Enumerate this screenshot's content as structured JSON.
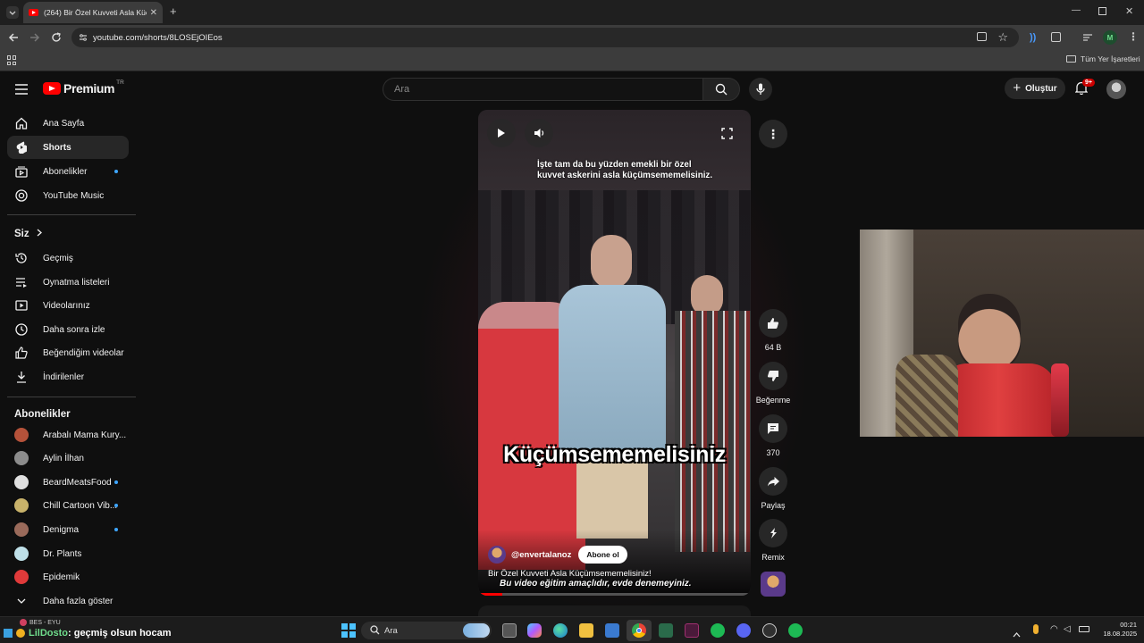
{
  "browser": {
    "tab_title": "(264) Bir Özel Kuvveti Asla Küçü",
    "url": "youtube.com/shorts/8LOSEjOIEos",
    "bookmarks_label": "Tüm Yer İşaretleri",
    "profile_initial": "M"
  },
  "header": {
    "logo_text": "Premium",
    "logo_region": "TR",
    "search_placeholder": "Ara",
    "create_label": "Oluştur",
    "notif_badge": "9+"
  },
  "sidebar": {
    "main": [
      {
        "label": "Ana Sayfa",
        "icon": "home-icon"
      },
      {
        "label": "Shorts",
        "icon": "shorts-icon",
        "active": true
      },
      {
        "label": "Abonelikler",
        "icon": "subscriptions-icon",
        "dot": true
      },
      {
        "label": "YouTube Music",
        "icon": "music-icon"
      }
    ],
    "you_title": "Siz",
    "you": [
      {
        "label": "Geçmiş",
        "icon": "history-icon"
      },
      {
        "label": "Oynatma listeleri",
        "icon": "playlist-icon"
      },
      {
        "label": "Videolarınız",
        "icon": "your-videos-icon"
      },
      {
        "label": "Daha sonra izle",
        "icon": "watch-later-icon"
      },
      {
        "label": "Beğendiğim videolar",
        "icon": "liked-icon"
      },
      {
        "label": "İndirilenler",
        "icon": "download-icon"
      }
    ],
    "subs_title": "Abonelikler",
    "subs": [
      {
        "label": "Arabalı Mama Kury...",
        "color": "#b5523a"
      },
      {
        "label": "Aylin İlhan",
        "color": "#8c8c8c"
      },
      {
        "label": "BeardMeatsFood",
        "color": "#e0e0e0",
        "dot": true
      },
      {
        "label": "Chill Cartoon Vib...",
        "color": "#c8b26a",
        "dot": true
      },
      {
        "label": "Denigma",
        "color": "#9a6a5a",
        "dot": true
      },
      {
        "label": "Dr. Plants",
        "color": "#bfe0e8"
      },
      {
        "label": "Epidemik",
        "color": "#e03a3a"
      }
    ],
    "more_label": "Daha fazla göster"
  },
  "short": {
    "caption_top": "İşte tam da bu yüzden emekli bir özel kuvvet askerini asla küçümsememelisiniz.",
    "big_text": "Küçümsememelisiniz",
    "channel": "@envertalanoz",
    "subscribe_label": "Abone ol",
    "title": "Bir Özel Kuvveti Asla Küçümsememelisiniz!",
    "subtitle": "Bu video eğitim amaçlıdır, evde denemeyiniz.",
    "progress": 0.09
  },
  "actions": {
    "likes": "64 B",
    "dislike_label": "Beğenme",
    "comments": "370",
    "share_label": "Paylaş",
    "remix_label": "Remix"
  },
  "overlay": {
    "top_label": "BES - EYU",
    "chat_user": "LilDosto",
    "chat_message": ": geçmiş olsun hocam"
  },
  "taskbar": {
    "search_label": "Ara",
    "time": "00:21",
    "date": "18.08.2025"
  },
  "colors": {
    "brand": "#ff0000",
    "accent": "#3ea6ff",
    "bg": "#0f0f0f"
  }
}
